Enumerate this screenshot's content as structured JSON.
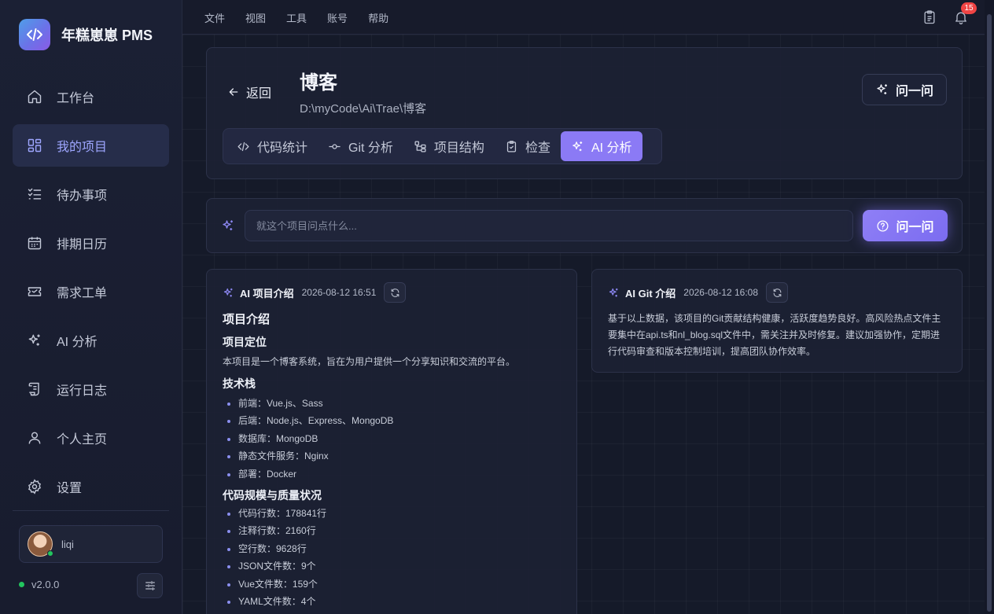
{
  "app": {
    "name": "年糕崽崽 PMS",
    "version": "v2.0.0"
  },
  "sidebar": {
    "items": [
      {
        "label": "工作台",
        "icon": "home-icon"
      },
      {
        "label": "我的项目",
        "icon": "grid-icon",
        "active": true
      },
      {
        "label": "待办事项",
        "icon": "checklist-icon"
      },
      {
        "label": "排期日历",
        "icon": "calendar-icon"
      },
      {
        "label": "需求工单",
        "icon": "ticket-icon"
      },
      {
        "label": "AI 分析",
        "icon": "sparkles-icon"
      },
      {
        "label": "运行日志",
        "icon": "scroll-icon"
      },
      {
        "label": "个人主页",
        "icon": "user-icon"
      },
      {
        "label": "设置",
        "icon": "gear-icon"
      }
    ],
    "user": {
      "name": "liqi",
      "status": "online"
    }
  },
  "topbar": {
    "menu": [
      "文件",
      "视图",
      "工具",
      "账号",
      "帮助"
    ],
    "notification_count": "15"
  },
  "project": {
    "back_label": "返回",
    "title": "博客",
    "path": "D:\\myCode\\Ai\\Trae\\博客",
    "ask_label": "问一问",
    "tabs": [
      {
        "label": "代码统计",
        "icon": "code-icon"
      },
      {
        "label": "Git 分析",
        "icon": "git-commit-icon"
      },
      {
        "label": "项目结构",
        "icon": "structure-icon"
      },
      {
        "label": "检查",
        "icon": "clipboard-check-icon"
      },
      {
        "label": "AI 分析",
        "icon": "sparkles-icon",
        "active": true
      }
    ]
  },
  "ask": {
    "placeholder": "就这个项目问点什么...",
    "button_label": "问一问"
  },
  "intro_card": {
    "title": "AI 项目介绍",
    "time": "2026-08-12 16:51",
    "heading": "项目介绍",
    "positioning_title": "项目定位",
    "positioning_text": "本项目是一个博客系统，旨在为用户提供一个分享知识和交流的平台。",
    "stack_title": "技术栈",
    "stack": [
      "前端：Vue.js、Sass",
      "后端：Node.js、Express、MongoDB",
      "数据库：MongoDB",
      "静态文件服务：Nginx",
      "部署：Docker"
    ],
    "quality_title": "代码规模与质量状况",
    "quality": [
      "代码行数：178841行",
      "注释行数：2160行",
      "空行数：9628行",
      "JSON文件数：9个",
      "Vue文件数：159个",
      "YAML文件数：4个"
    ]
  },
  "git_card": {
    "title": "AI Git 介绍",
    "time": "2026-08-12 16:08",
    "text": "基于以上数据，该项目的Git贡献结构健康，活跃度趋势良好。高风险热点文件主要集中在api.ts和nl_blog.sql文件中，需关注并及时修复。建议加强协作，定期进行代码审查和版本控制培训，提高团队协作效率。"
  },
  "colors": {
    "accent": "#8b7af5",
    "active_nav_bg": "#262d4a",
    "online": "#22c55e",
    "badge": "#ef4444"
  }
}
